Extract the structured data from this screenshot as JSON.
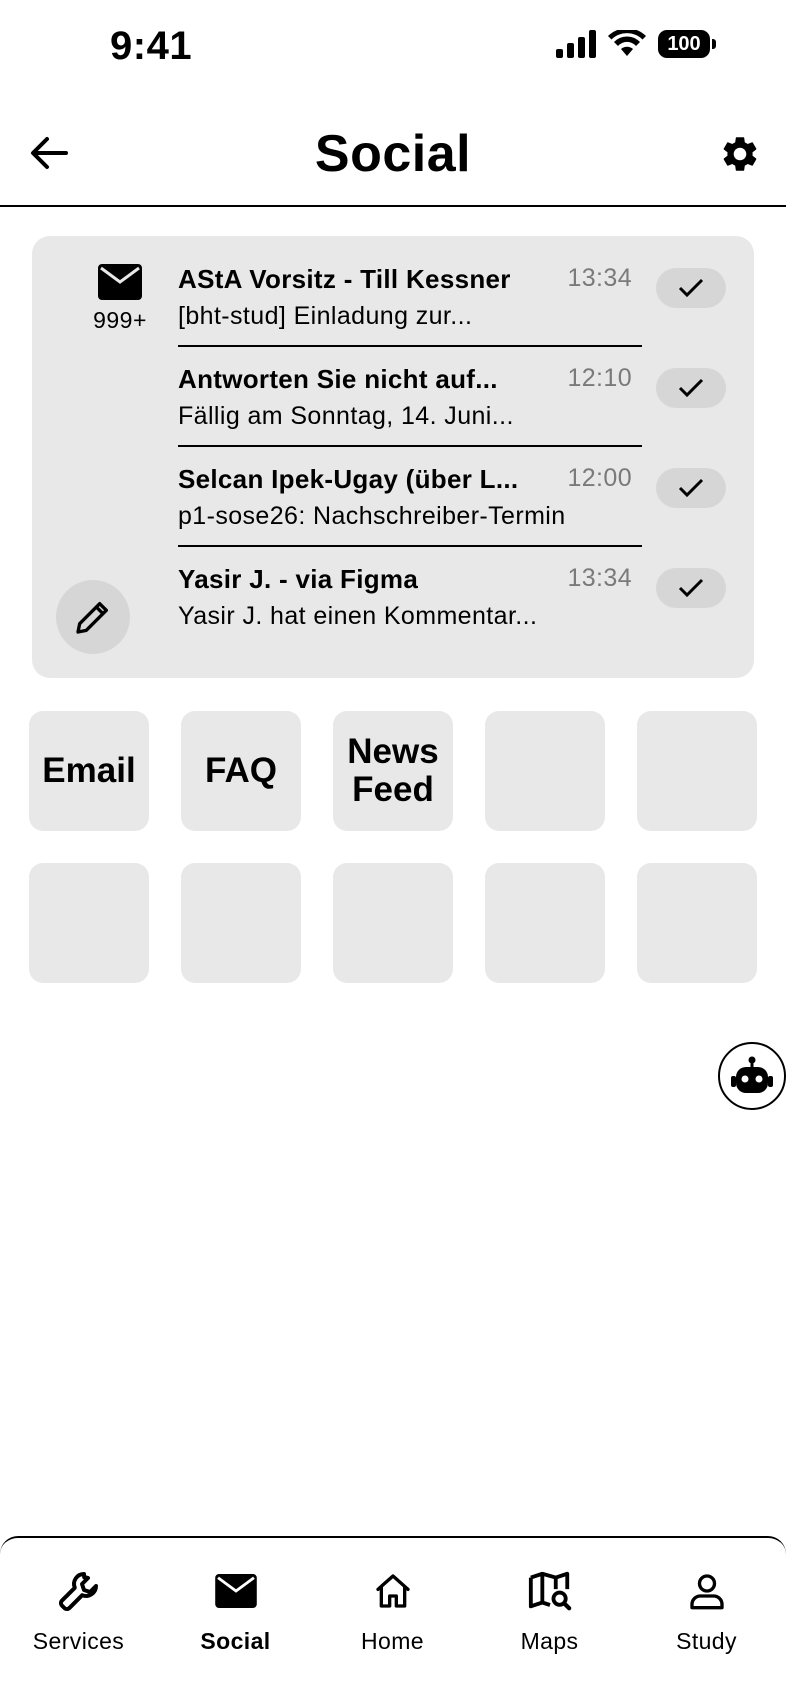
{
  "status_bar": {
    "time": "9:41",
    "battery": "100"
  },
  "header": {
    "title": "Social"
  },
  "mail": {
    "unread_count": "999+",
    "messages": [
      {
        "sender": "AStA Vorsitz - Till Kessner",
        "time": "13:34",
        "preview": "[bht-stud] Einladung zur..."
      },
      {
        "sender": "Antworten Sie nicht auf...",
        "time": "12:10",
        "preview": "Fällig am Sonntag, 14. Juni..."
      },
      {
        "sender": "Selcan Ipek-Ugay (über L...",
        "time": "12:00",
        "preview": "p1-sose26: Nachschreiber-Termin"
      },
      {
        "sender": "Yasir J. - via Figma",
        "time": "13:34",
        "preview": "Yasir J. hat einen Kommentar..."
      }
    ]
  },
  "tiles": {
    "row1": [
      "Email",
      "FAQ",
      "News Feed",
      "",
      ""
    ],
    "row2": [
      "",
      "",
      "",
      "",
      ""
    ]
  },
  "tab_bar": {
    "items": [
      {
        "label": "Services",
        "icon": "wrench-icon"
      },
      {
        "label": "Social",
        "icon": "mail-icon"
      },
      {
        "label": "Home",
        "icon": "home-icon"
      },
      {
        "label": "Maps",
        "icon": "map-search-icon"
      },
      {
        "label": "Study",
        "icon": "person-icon"
      }
    ],
    "active": "Social"
  }
}
